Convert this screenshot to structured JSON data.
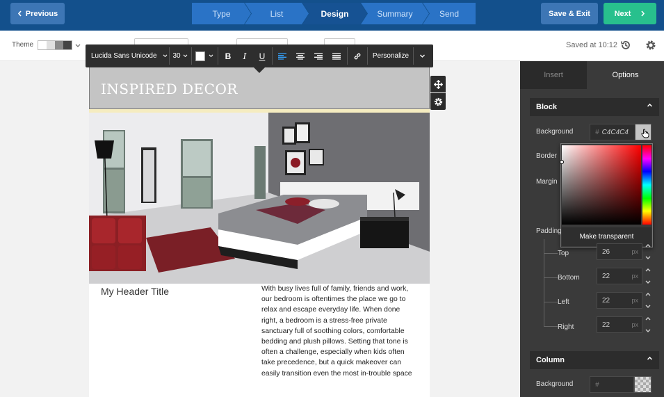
{
  "topbar": {
    "previous_label": "Previous",
    "steps": [
      "Type",
      "List",
      "Design",
      "Summary",
      "Send"
    ],
    "active_step": "Design",
    "save_exit_label": "Save & Exit",
    "next_label": "Next"
  },
  "subbar": {
    "theme_label": "Theme",
    "theme_colors": [
      "#ffffff",
      "#e0e0e0",
      "#8a8a8a",
      "#444444"
    ],
    "saved_text": "Saved at 10:12"
  },
  "toolbar": {
    "font": "Lucida Sans Unicode",
    "size": "30",
    "text_color": "#ffffff",
    "bold": "B",
    "italic": "I",
    "underline": "U",
    "personalize": "Personalize"
  },
  "email": {
    "brand": "INSPIRED DECOR",
    "header_bg": "#c4c4c4",
    "title": "My Header Title",
    "paragraph_lines": [
      "With busy lives full of family, friends and work,",
      "our bedroom is oftentimes the place we go to",
      "relax and escape everyday life. When done",
      "right, a bedroom is a stress-free private",
      "sanctuary full of soothing colors, comfortable",
      "bedding and plush pillows. Setting that tone is",
      "often a challenge, especially when kids often",
      "take precedence, but a quick makeover can",
      "easily transition even the most in-trouble space"
    ]
  },
  "panel": {
    "tabs": [
      "Insert",
      "Options"
    ],
    "active_tab": "Options",
    "block": {
      "title": "Block",
      "background_label": "Background",
      "hash": "#",
      "background_value": "C4C4C4",
      "border_label": "Border",
      "margin_label": "Margin",
      "make_transparent": "Make transparent",
      "padding_label": "Padding",
      "unit": "px",
      "padding": [
        {
          "label": "Top",
          "value": "26"
        },
        {
          "label": "Bottom",
          "value": "22"
        },
        {
          "label": "Left",
          "value": "22"
        },
        {
          "label": "Right",
          "value": "22"
        }
      ]
    },
    "column": {
      "title": "Column",
      "background_label": "Background",
      "hash": "#"
    }
  }
}
